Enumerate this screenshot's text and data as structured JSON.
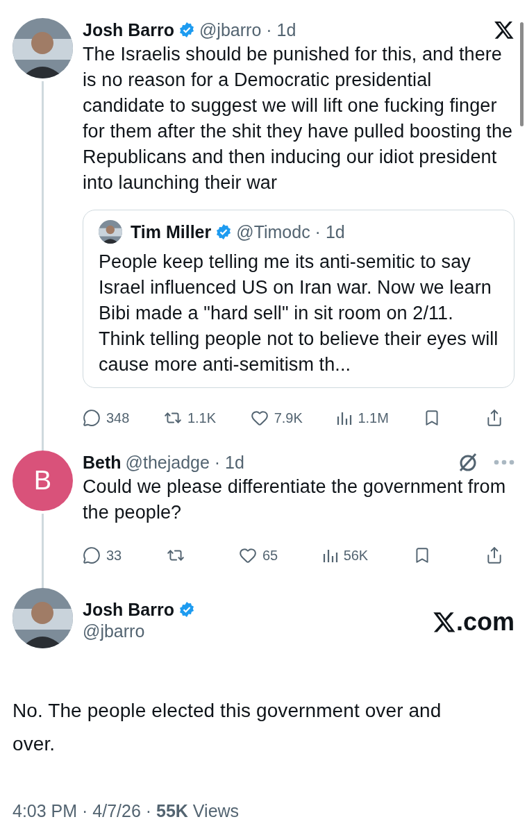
{
  "thread": [
    {
      "kind": "avatar",
      "author": {
        "name": "Josh Barro",
        "verified": true,
        "meta": "@jbarro · 1d"
      },
      "text": "The Israelis should be punished for this, and there is no reason for a Democratic presidential candidate to suggest we will lift one fucking finger for them after the shit they have pulled boosting the Republicans and then inducing our idiot president into launching their war",
      "quote": {
        "author": {
          "name": "Tim Miller",
          "verified": true,
          "meta": "@Timodc · 1d"
        },
        "text": "People keep telling me its anti-semitic to say Israel influenced US on Iran war. Now we learn Bibi made a \"hard sell\" in sit room on 2/11. Think telling people not to believe their eyes will cause more anti-semitism th..."
      },
      "stats": [
        {
          "kind": "reply",
          "count": "348"
        },
        {
          "kind": "repost",
          "count": "1.1K"
        },
        {
          "kind": "like",
          "count": "7.9K"
        },
        {
          "kind": "views",
          "count": "1.1M"
        },
        {
          "kind": "bookmark"
        },
        {
          "kind": "share"
        }
      ]
    },
    {
      "kind": "initial",
      "initial": "B",
      "color": "#d9527a",
      "author": {
        "name": "Beth",
        "verified": false,
        "meta": "@thejadge · 1d"
      },
      "text": "Could we please differentiate the government from the people?",
      "stats": [
        {
          "kind": "reply",
          "count": "33"
        },
        {
          "kind": "repost"
        },
        {
          "kind": "like",
          "count": "65"
        },
        {
          "kind": "views",
          "count": "56K"
        },
        {
          "kind": "bookmark"
        },
        {
          "kind": "share"
        }
      ]
    }
  ],
  "main": {
    "author": {
      "name": "Josh Barro",
      "verified": true,
      "handle": "@jbarro"
    },
    "site": ".com",
    "text": "No. The people elected this government over and over.",
    "footer": "4:03 PM · 4/7/26 · **55K** Views"
  }
}
